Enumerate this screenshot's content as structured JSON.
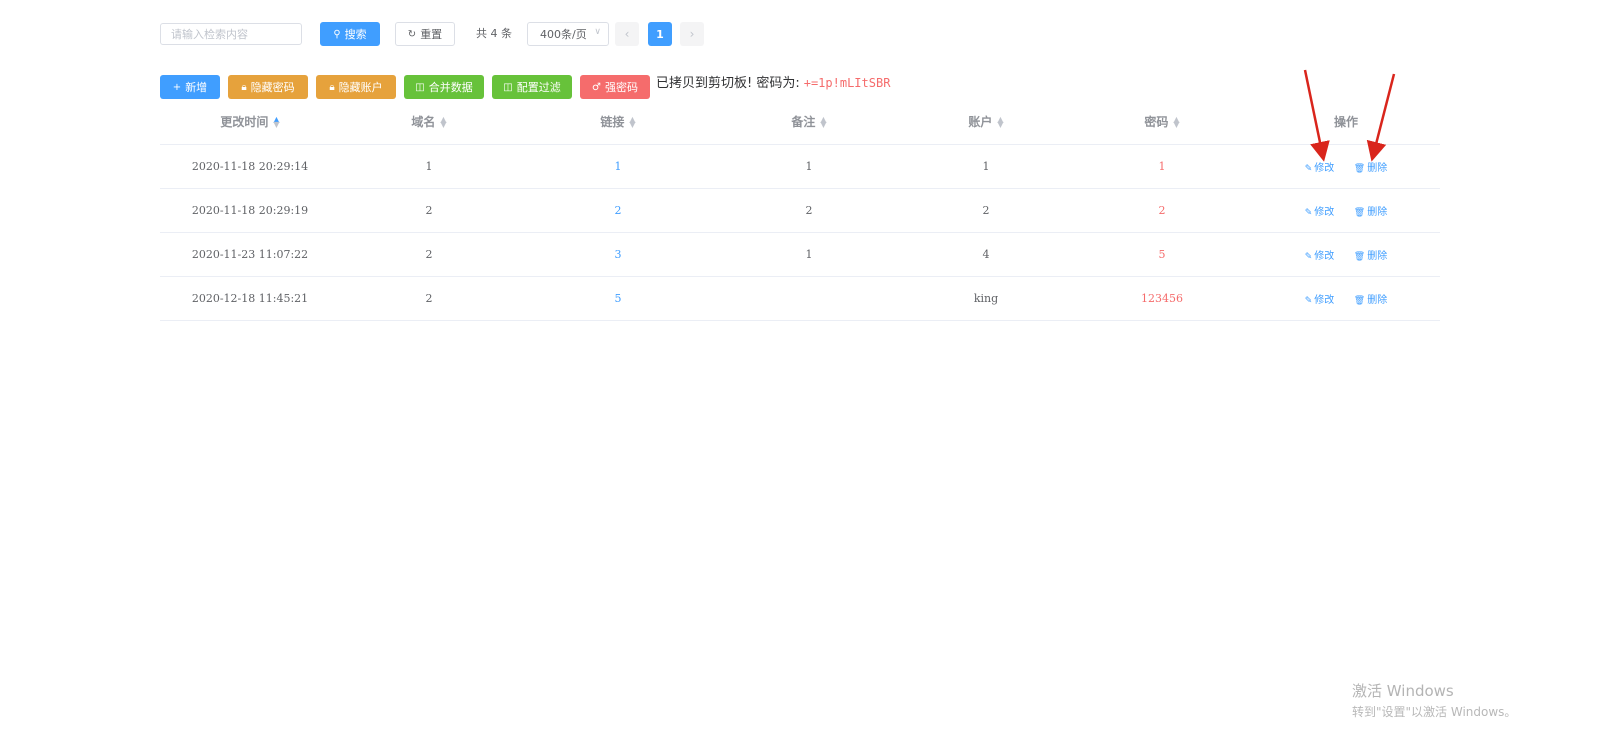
{
  "toolbar": {
    "search_placeholder": "请输入检索内容",
    "search_label": "搜索",
    "reset_label": "重置",
    "total_text": "共 4 条",
    "page_size": "400条/页",
    "current_page": "1"
  },
  "actions": {
    "add": "新增",
    "hide_password": "隐藏密码",
    "hide_account": "隐藏账户",
    "merge_data": "合并数据",
    "config_filter": "配置过滤",
    "strong_password": "强密码",
    "copied_message": "已拷贝到剪切板! 密码为:",
    "copied_password": "+=1p!mLItSBR"
  },
  "table": {
    "columns": [
      "更改时间",
      "域名",
      "链接",
      "备注",
      "账户",
      "密码",
      "操作"
    ],
    "edit_label": "修改",
    "delete_label": "删除",
    "rows": [
      {
        "time": "2020-11-18 20:29:14",
        "domain": "1",
        "link": "1",
        "note": "1",
        "account": "1",
        "password": "1"
      },
      {
        "time": "2020-11-18 20:29:19",
        "domain": "2",
        "link": "2",
        "note": "2",
        "account": "2",
        "password": "2"
      },
      {
        "time": "2020-11-23 11:07:22",
        "domain": "2",
        "link": "3",
        "note": "1",
        "account": "4",
        "password": "5"
      },
      {
        "time": "2020-12-18 11:45:21",
        "domain": "2",
        "link": "5",
        "note": "",
        "account": "king",
        "password": "123456"
      }
    ]
  },
  "watermark": {
    "title": "激活 Windows",
    "subtitle": "转到\"设置\"以激活 Windows。"
  },
  "colors": {
    "primary": "#409eff",
    "warning": "#e6a23c",
    "success": "#67c23a",
    "danger": "#f56c6c",
    "annotation_arrow": "#d9251c"
  },
  "icons": {
    "search": "search-icon",
    "reset": "refresh-icon",
    "add": "plus-icon",
    "lock": "lock-icon",
    "columns": "columns-icon",
    "key": "key-icon",
    "edit": "edit-icon",
    "delete": "trash-icon"
  }
}
